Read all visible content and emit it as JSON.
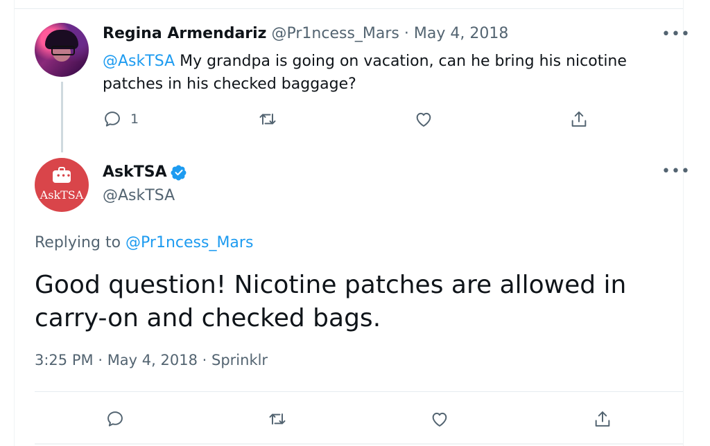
{
  "reply_to_tweet": {
    "author_name": "Regina Armendariz",
    "author_handle": "@Pr1ncess_Mars",
    "separator": "·",
    "date": "May 4, 2018",
    "mention": "@AskTSA",
    "text": " My grandpa is going on vacation, can he bring his nicotine patches in his checked baggage?",
    "reply_count": "1",
    "more_label": "•••"
  },
  "main_tweet": {
    "author_name": "AskTSA",
    "author_handle": "@AskTSA",
    "avatar_text": "AskTSA",
    "verified": true,
    "replying_prefix": "Replying to",
    "replying_handle": "@Pr1ncess_Mars",
    "text": "Good question! Nicotine patches are allowed in carry-on and checked bags.",
    "time": "3:25 PM",
    "separator": "·",
    "date": "May 4, 2018",
    "source": "Sprinklr",
    "more_label": "•••"
  },
  "colors": {
    "link": "#1d9bf0",
    "muted": "#536471",
    "text": "#0f1419",
    "tsa_avatar": "#d9454a"
  },
  "icons": [
    "reply-icon",
    "retweet-icon",
    "like-icon",
    "share-icon",
    "verified-badge-icon",
    "more-icon"
  ]
}
